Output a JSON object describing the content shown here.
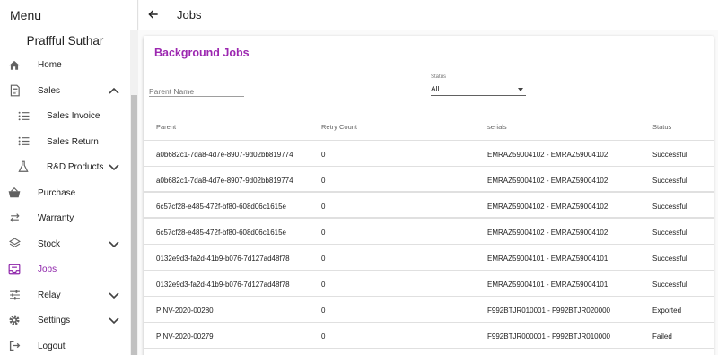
{
  "sidebar": {
    "menu_title": "Menu",
    "user_name": "Praffful Suthar",
    "items": [
      {
        "label": "Home",
        "icon": "home-icon"
      },
      {
        "label": "Sales",
        "icon": "receipt-icon"
      },
      {
        "label": "Sales Invoice",
        "icon": "list-icon"
      },
      {
        "label": "Sales Return",
        "icon": "list-icon"
      },
      {
        "label": "R&D Products",
        "icon": "flask-icon"
      },
      {
        "label": "Purchase",
        "icon": "basket-icon"
      },
      {
        "label": "Warranty",
        "icon": "swap-icon"
      },
      {
        "label": "Stock",
        "icon": "layers-icon"
      },
      {
        "label": "Jobs",
        "icon": "inbox-icon"
      },
      {
        "label": "Relay",
        "icon": "tune-icon"
      },
      {
        "label": "Settings",
        "icon": "gear-icon"
      },
      {
        "label": "Logout",
        "icon": "logout-icon"
      }
    ]
  },
  "header": {
    "title": "Jobs"
  },
  "card": {
    "title": "Background Jobs",
    "parent_placeholder": "Parent Name",
    "status_label": "Status",
    "status_value": "All"
  },
  "table": {
    "columns": [
      "Parent",
      "Retry Count",
      "serials",
      "Status"
    ],
    "rows": [
      [
        "a0b682c1-7da8-4d7e-8907-9d02bb819774",
        "0",
        "EMRAZ59004102 - EMRAZ59004102",
        "Successful"
      ],
      [
        "a0b682c1-7da8-4d7e-8907-9d02bb819774",
        "0",
        "EMRAZ59004102 - EMRAZ59004102",
        "Successful"
      ],
      [
        "6c57cf28-e485-472f-bf80-608d06c1615e",
        "0",
        "EMRAZ59004102 - EMRAZ59004102",
        "Successful"
      ],
      [
        "6c57cf28-e485-472f-bf80-608d06c1615e",
        "0",
        "EMRAZ59004102 - EMRAZ59004102",
        "Successful"
      ],
      [
        "0132e9d3-fa2d-41b9-b076-7d127ad48f78",
        "0",
        "EMRAZ59004101 - EMRAZ59004101",
        "Successful"
      ],
      [
        "0132e9d3-fa2d-41b9-b076-7d127ad48f78",
        "0",
        "EMRAZ59004101 - EMRAZ59004101",
        "Successful"
      ],
      [
        "PINV-2020-00280",
        "0",
        "F992BTJR010001 - F992BTJR020000",
        "Exported"
      ],
      [
        "PINV-2020-00279",
        "0",
        "F992BTJR000001 - F992BTJR010000",
        "Failed"
      ]
    ]
  },
  "colors": {
    "accent": "#9c27b0",
    "active_nav": "#8e24aa",
    "icon": "#616161"
  }
}
